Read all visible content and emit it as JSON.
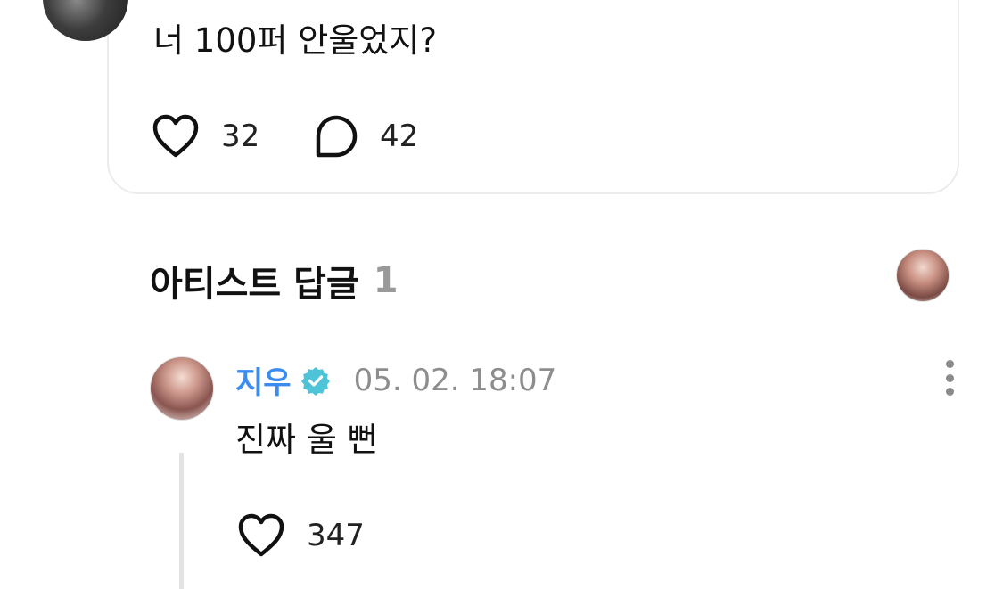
{
  "post": {
    "text": "너 100퍼 안울었지?",
    "likes": "32",
    "comments": "42"
  },
  "section": {
    "title": "아티스트 답글",
    "count": "1"
  },
  "reply": {
    "author": "지우",
    "date": "05. 02. 18:07",
    "text": "진짜 울 뻔",
    "likes": "347"
  },
  "colors": {
    "author": "#3c8cf0",
    "verified": "#4fc3d8",
    "muted": "#8d8d8d",
    "thread_line": "#e3e3e3"
  },
  "icons": [
    "heart-icon",
    "comment-bubble-icon",
    "verified-badge-icon",
    "more-vertical-icon"
  ]
}
